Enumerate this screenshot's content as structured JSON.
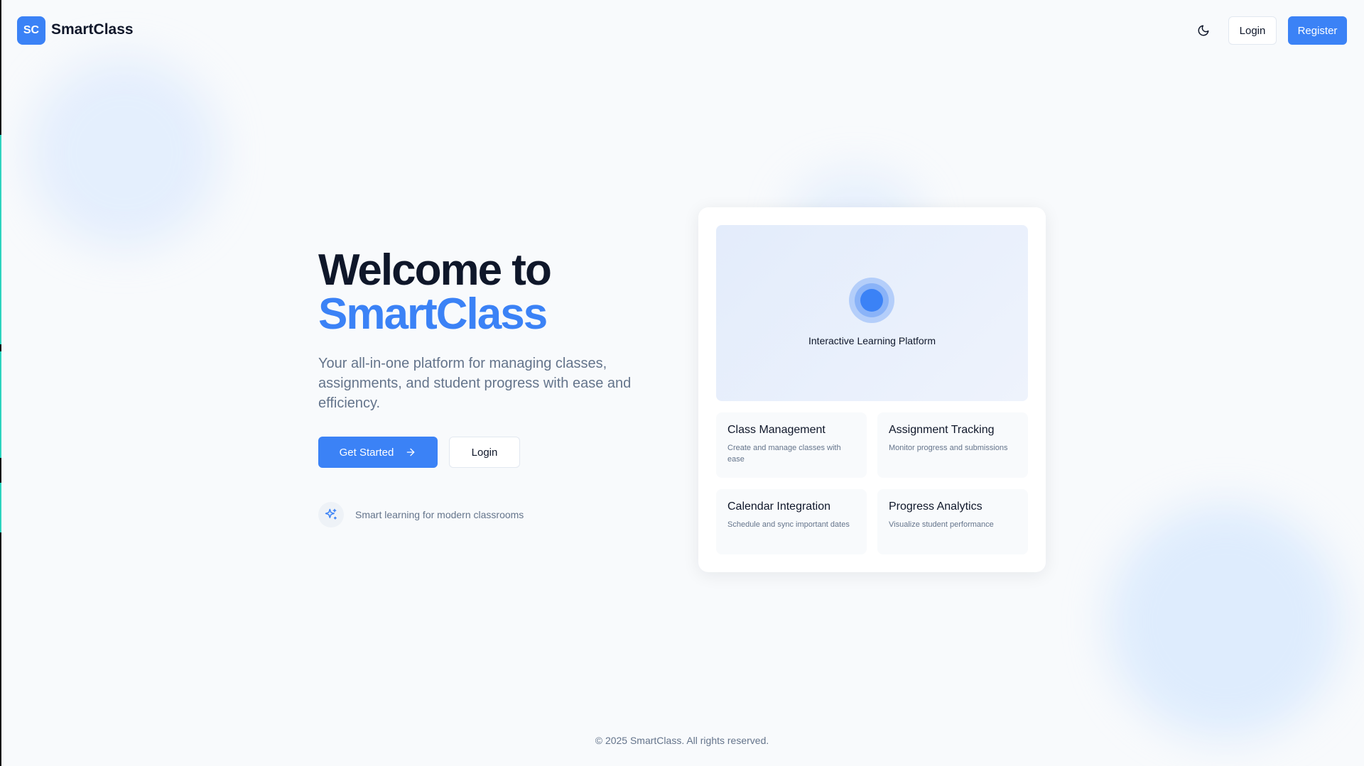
{
  "header": {
    "logo_text": "SC",
    "brand": "SmartClass",
    "theme_toggle_icon": "moon-icon",
    "login_label": "Login",
    "register_label": "Register"
  },
  "hero": {
    "title_line1": "Welcome to",
    "title_line2": "SmartClass",
    "subtitle": "Your all-in-one platform for managing classes, assignments, and student progress with ease and efficiency.",
    "get_started_label": "Get Started",
    "get_started_icon": "arrow-right-icon",
    "login_label": "Login",
    "tagline_icon": "sparkles-icon",
    "tagline": "Smart learning for modern classrooms"
  },
  "showcase": {
    "label": "Interactive Learning Platform",
    "features": [
      {
        "title": "Class Management",
        "description": "Create and manage classes with ease"
      },
      {
        "title": "Assignment Tracking",
        "description": "Monitor progress and submissions"
      },
      {
        "title": "Calendar Integration",
        "description": "Schedule and sync important dates"
      },
      {
        "title": "Progress Analytics",
        "description": "Visualize student performance"
      }
    ]
  },
  "footer": {
    "copyright": "© 2025 SmartClass. All rights reserved."
  },
  "colors": {
    "primary": "#3b82f6",
    "background": "#f8fafc",
    "text": "#0f172a",
    "muted": "#64748b"
  }
}
